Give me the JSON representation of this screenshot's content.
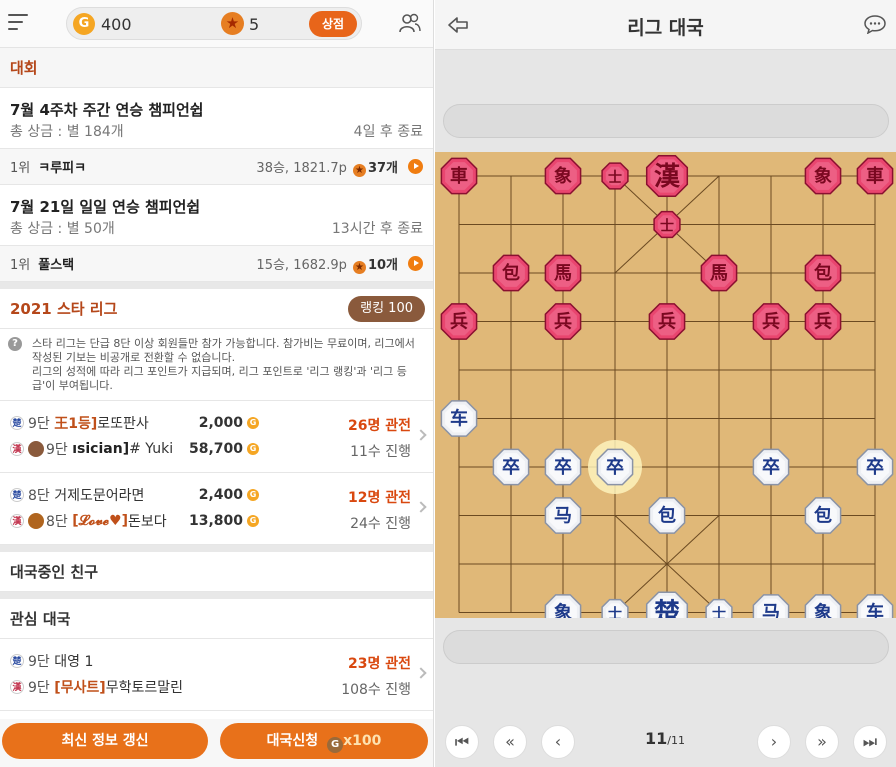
{
  "topbar": {
    "coins": "400",
    "stars": "5",
    "shop_label": "상점",
    "coin_glyph": "G",
    "star_glyph": "★"
  },
  "tournaments": {
    "section_title": "대회",
    "items": [
      {
        "title": "7월 4주차 주간 연승 챔피언쉽",
        "prize": "총 상금 : 별 184개",
        "time_left": "4일 후 종료",
        "rank": "1위",
        "leader": "ㅋ루피ㅋ",
        "stats": "38승, 1821.7p",
        "reward": "37개"
      },
      {
        "title": "7월 21일 일일 연승 챔피언쉽",
        "prize": "총 상금 : 별 50개",
        "time_left": "13시간 후 종료",
        "rank": "1위",
        "leader": "풀스택",
        "stats": "15승, 1682.9p",
        "reward": "10개"
      }
    ]
  },
  "league": {
    "title": "2021 스타 리그",
    "ranking_label": "랭킹 100",
    "notice": "스타 리그는 단급 8단 이상 회원들만 참가 가능합니다. 참가비는 무료이며, 리그에서 작성된 기보는 비공개로 전환할 수 없습니다.\n리그의 성적에 따라 리그 포인트가 지급되며, 리그 포인트로 '리그 랭킹'과 '리그 등급'이 부여됩니다.",
    "games": [
      {
        "p1": {
          "side": "楚",
          "rank": "9단",
          "tag": "王1등]",
          "name": "로또판사",
          "gold": "2,000"
        },
        "p2": {
          "side": "漢",
          "rank": "9단",
          "tag": "ısician]",
          "name": "# Yuki",
          "gold": "58,700"
        },
        "watchers": "26명 관전",
        "moves": "11수 진행"
      },
      {
        "p1": {
          "side": "楚",
          "rank": "8단",
          "tag": "",
          "name": "거제도문어라면",
          "gold": "2,400"
        },
        "p2": {
          "side": "漢",
          "rank": "8단",
          "tag": "[𝓛𝓸𝓿𝓮♥]",
          "name": "돈보다",
          "gold": "13,800"
        },
        "watchers": "12명 관전",
        "moves": "24수 진행"
      }
    ]
  },
  "friends_section": "대국중인 친구",
  "interest": {
    "section_title": "관심 대국",
    "game": {
      "p1": {
        "side": "楚",
        "rank": "9단",
        "name": "대영 1"
      },
      "p2": {
        "side": "漢",
        "rank": "9단",
        "tag": "[무사트]",
        "name": "무학토르말린"
      },
      "watchers": "23명 관전",
      "moves": "108수 진행"
    }
  },
  "bottom": {
    "refresh_label": "최신 정보 갱신",
    "request_label": "대국신청",
    "request_cost": "x100"
  },
  "board_view": {
    "title": "리그 대국",
    "move_current": "11",
    "move_total": "/11",
    "pieces": [
      {
        "side": "han",
        "char": "車",
        "col": 0,
        "row": 0
      },
      {
        "side": "han",
        "char": "象",
        "col": 2,
        "row": 0
      },
      {
        "side": "han",
        "char": "士",
        "col": 3,
        "row": 0
      },
      {
        "side": "han",
        "char": "漢",
        "col": 4,
        "row": 0,
        "big": true
      },
      {
        "side": "han",
        "char": "象",
        "col": 7,
        "row": 0
      },
      {
        "side": "han",
        "char": "車",
        "col": 8,
        "row": 0
      },
      {
        "side": "han",
        "char": "士",
        "col": 4,
        "row": 1
      },
      {
        "side": "han",
        "char": "包",
        "col": 1,
        "row": 2
      },
      {
        "side": "han",
        "char": "馬",
        "col": 2,
        "row": 2
      },
      {
        "side": "han",
        "char": "馬",
        "col": 5,
        "row": 2
      },
      {
        "side": "han",
        "char": "包",
        "col": 7,
        "row": 2
      },
      {
        "side": "han",
        "char": "兵",
        "col": 0,
        "row": 3
      },
      {
        "side": "han",
        "char": "兵",
        "col": 2,
        "row": 3
      },
      {
        "side": "han",
        "char": "兵",
        "col": 4,
        "row": 3
      },
      {
        "side": "han",
        "char": "兵",
        "col": 6,
        "row": 3
      },
      {
        "side": "han",
        "char": "兵",
        "col": 7,
        "row": 3
      },
      {
        "side": "cho",
        "char": "车",
        "col": 0,
        "row": 5
      },
      {
        "side": "cho",
        "char": "卒",
        "col": 1,
        "row": 6
      },
      {
        "side": "cho",
        "char": "卒",
        "col": 2,
        "row": 6
      },
      {
        "side": "cho",
        "char": "卒",
        "col": 3,
        "row": 6,
        "glow": true
      },
      {
        "side": "cho",
        "char": "卒",
        "col": 6,
        "row": 6
      },
      {
        "side": "cho",
        "char": "卒",
        "col": 8,
        "row": 6
      },
      {
        "side": "cho",
        "char": "马",
        "col": 2,
        "row": 7
      },
      {
        "side": "cho",
        "char": "包",
        "col": 4,
        "row": 7
      },
      {
        "side": "cho",
        "char": "包",
        "col": 7,
        "row": 7
      },
      {
        "side": "cho",
        "char": "象",
        "col": 2,
        "row": 9
      },
      {
        "side": "cho",
        "char": "士",
        "col": 3,
        "row": 9
      },
      {
        "side": "cho",
        "char": "楚",
        "col": 4,
        "row": 9,
        "big": true
      },
      {
        "side": "cho",
        "char": "士",
        "col": 5,
        "row": 9
      },
      {
        "side": "cho",
        "char": "马",
        "col": 6,
        "row": 9
      },
      {
        "side": "cho",
        "char": "象",
        "col": 7,
        "row": 9
      },
      {
        "side": "cho",
        "char": "车",
        "col": 8,
        "row": 9
      }
    ]
  },
  "colors": {
    "accent": "#e8711a",
    "section_title": "#b5471a",
    "watchers": "#d9480f",
    "han_piece": "#c0304a",
    "cho_piece": "#1e3a8a"
  }
}
